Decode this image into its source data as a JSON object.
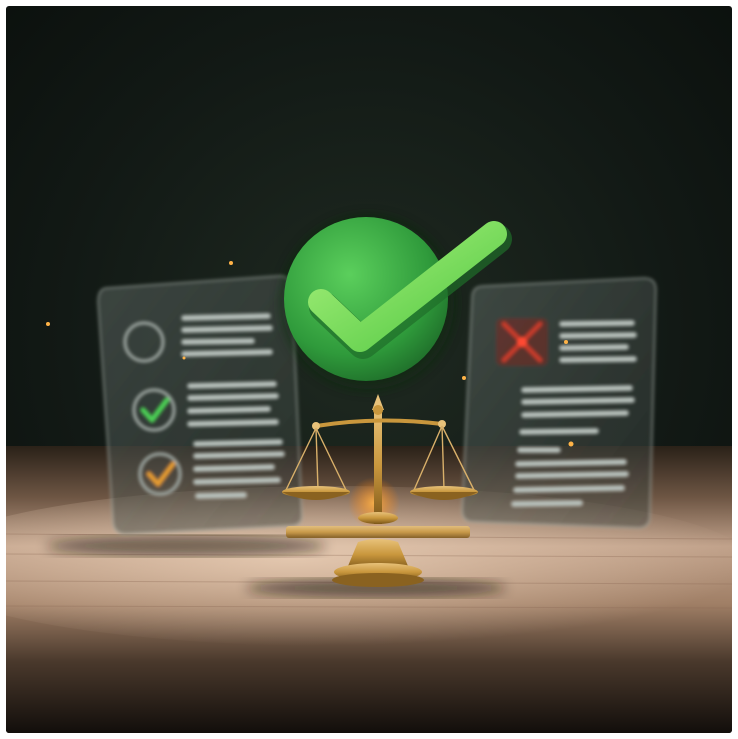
{
  "scene": {
    "kind": "illustration",
    "center_icon": "check-circle-icon",
    "object": "balance-scale-icon",
    "left_panel": {
      "rows": [
        {
          "status": "pending",
          "icon": "ring-icon"
        },
        {
          "status": "approved",
          "icon": "check-icon"
        },
        {
          "status": "approved",
          "icon": "check-icon"
        }
      ]
    },
    "right_panel": {
      "status": "rejected",
      "icon": "x-icon"
    },
    "colors": {
      "background": "#111712",
      "accent_green": "#3fb04a",
      "check_light": "#7be36b",
      "gold": "#c9973d",
      "amber_check": "#e39a32",
      "red_mark": "#c43a2a",
      "table": "#a7856a"
    }
  }
}
